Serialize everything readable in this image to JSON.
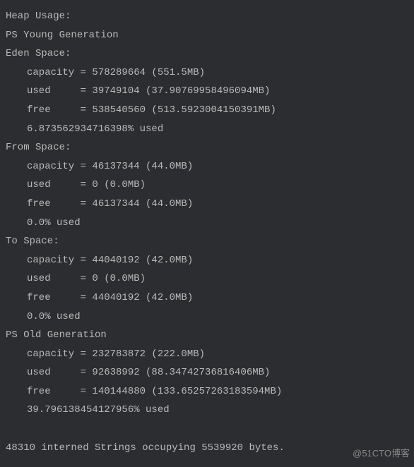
{
  "header": "Heap Usage:",
  "sections": [
    {
      "title": "PS Young Generation",
      "spaces": [
        {
          "name": "Eden Space:",
          "capacity_line": "capacity = 578289664 (551.5MB)",
          "used_line": "used     = 39749104 (37.90769958496094MB)",
          "free_line": "free     = 538540560 (513.5923004150391MB)",
          "percent_line": "6.873562934716398% used"
        },
        {
          "name": "From Space:",
          "capacity_line": "capacity = 46137344 (44.0MB)",
          "used_line": "used     = 0 (0.0MB)",
          "free_line": "free     = 46137344 (44.0MB)",
          "percent_line": "0.0% used"
        },
        {
          "name": "To Space:",
          "capacity_line": "capacity = 44040192 (42.0MB)",
          "used_line": "used     = 0 (0.0MB)",
          "free_line": "free     = 44040192 (42.0MB)",
          "percent_line": "0.0% used"
        }
      ]
    },
    {
      "title": "PS Old Generation",
      "spaces": [
        {
          "name": "",
          "capacity_line": "capacity = 232783872 (222.0MB)",
          "used_line": "used     = 92638992 (88.34742736816406MB)",
          "free_line": "free     = 140144880 (133.65257263183594MB)",
          "percent_line": "39.796138454127956% used"
        }
      ]
    }
  ],
  "blank": " ",
  "footer": "48310 interned Strings occupying 5539920 bytes.",
  "watermark": "@51CTO博客"
}
